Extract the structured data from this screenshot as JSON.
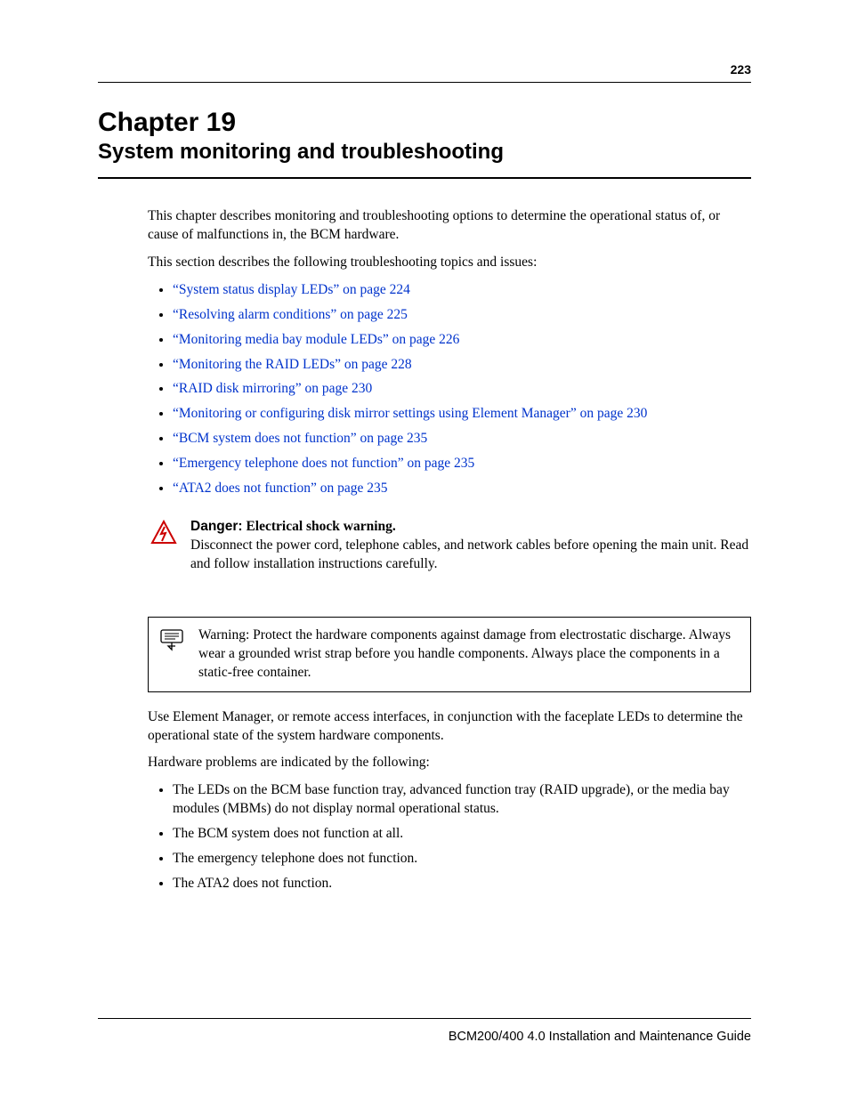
{
  "pageNumber": "223",
  "chapter": {
    "title": "Chapter 19",
    "subtitle": "System monitoring and troubleshooting"
  },
  "intro": {
    "p1": "This chapter describes monitoring and troubleshooting options to determine the operational status of, or cause of malfunctions in, the BCM hardware.",
    "p2": "This section describes the following troubleshooting topics and issues:"
  },
  "links": [
    "“System status display LEDs” on page 224",
    "“Resolving alarm conditions” on page 225",
    "“Monitoring media bay module LEDs” on page 226",
    "“Monitoring the RAID LEDs” on page 228",
    "“RAID disk mirroring” on page 230",
    "“Monitoring or configuring disk mirror settings using Element Manager” on page 230",
    "“BCM system does not function” on page 235",
    "“Emergency telephone does not function” on page 235",
    "“ATA2 does not function” on page 235"
  ],
  "danger": {
    "lead": "Danger:",
    "subtitle": "Electrical shock warning",
    "body": "Disconnect the power cord, telephone cables, and network cables before opening the main unit. Read and follow installation instructions carefully."
  },
  "warning": {
    "lead": "Warning:",
    "body": "Protect the hardware components against damage from electrostatic discharge. Always wear a grounded wrist strap before you handle components. Always place the components in a static-free container."
  },
  "afterWarning": {
    "p1": "Use Element Manager, or remote access interfaces, in conjunction with the faceplate LEDs to determine the operational state of the system hardware components.",
    "p2": "Hardware problems are indicated by the following:"
  },
  "problems": [
    "The LEDs on the BCM base function tray, advanced function tray (RAID upgrade), or the media bay modules (MBMs) do not display normal operational status.",
    "The BCM system does not function at all.",
    "The emergency telephone does not function.",
    "The ATA2 does not function."
  ],
  "footer": "BCM200/400 4.0 Installation and Maintenance Guide"
}
